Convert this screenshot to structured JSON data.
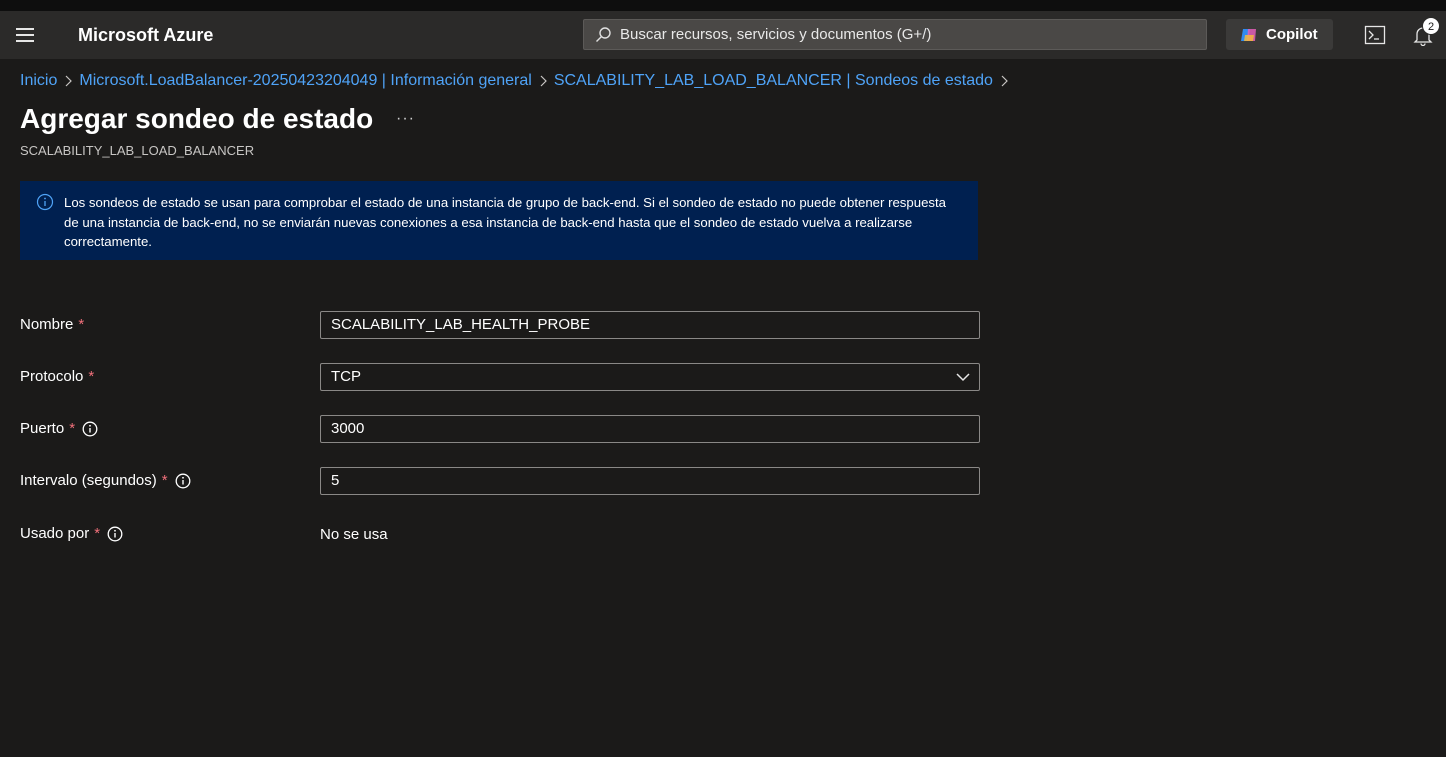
{
  "header": {
    "brand": "Microsoft Azure",
    "search_placeholder": "Buscar recursos, servicios y documentos (G+/)",
    "copilot_label": "Copilot",
    "notification_count": "2"
  },
  "breadcrumb": [
    {
      "label": "Inicio"
    },
    {
      "label": "Microsoft.LoadBalancer-20250423204049 | Información general"
    },
    {
      "label": "SCALABILITY_LAB_LOAD_BALANCER | Sondeos de estado"
    }
  ],
  "page": {
    "title": "Agregar sondeo de estado",
    "more_label": "···",
    "subtitle": "SCALABILITY_LAB_LOAD_BALANCER"
  },
  "info_banner": {
    "text": "Los sondeos de estado se usan para comprobar el estado de una instancia de grupo de back-end. Si el sondeo de estado no puede obtener respuesta de una instancia de back-end, no se enviarán nuevas conexiones a esa instancia de back-end hasta que el sondeo de estado vuelva a realizarse correctamente."
  },
  "form": {
    "nombre": {
      "label": "Nombre",
      "required_mark": "*",
      "value": "SCALABILITY_LAB_HEALTH_PROBE"
    },
    "protocolo": {
      "label": "Protocolo",
      "required_mark": "*",
      "value": "TCP"
    },
    "puerto": {
      "label": "Puerto",
      "required_mark": "*",
      "value": "3000"
    },
    "intervalo": {
      "label": "Intervalo (segundos)",
      "required_mark": "*",
      "value": "5"
    },
    "usado_por": {
      "label": "Usado por",
      "required_mark": "*",
      "value": "No se usa"
    }
  },
  "colors": {
    "link": "#4fa3f7",
    "banner_bg": "#002050",
    "required": "#f1707b",
    "page_bg": "#1b1a19"
  }
}
